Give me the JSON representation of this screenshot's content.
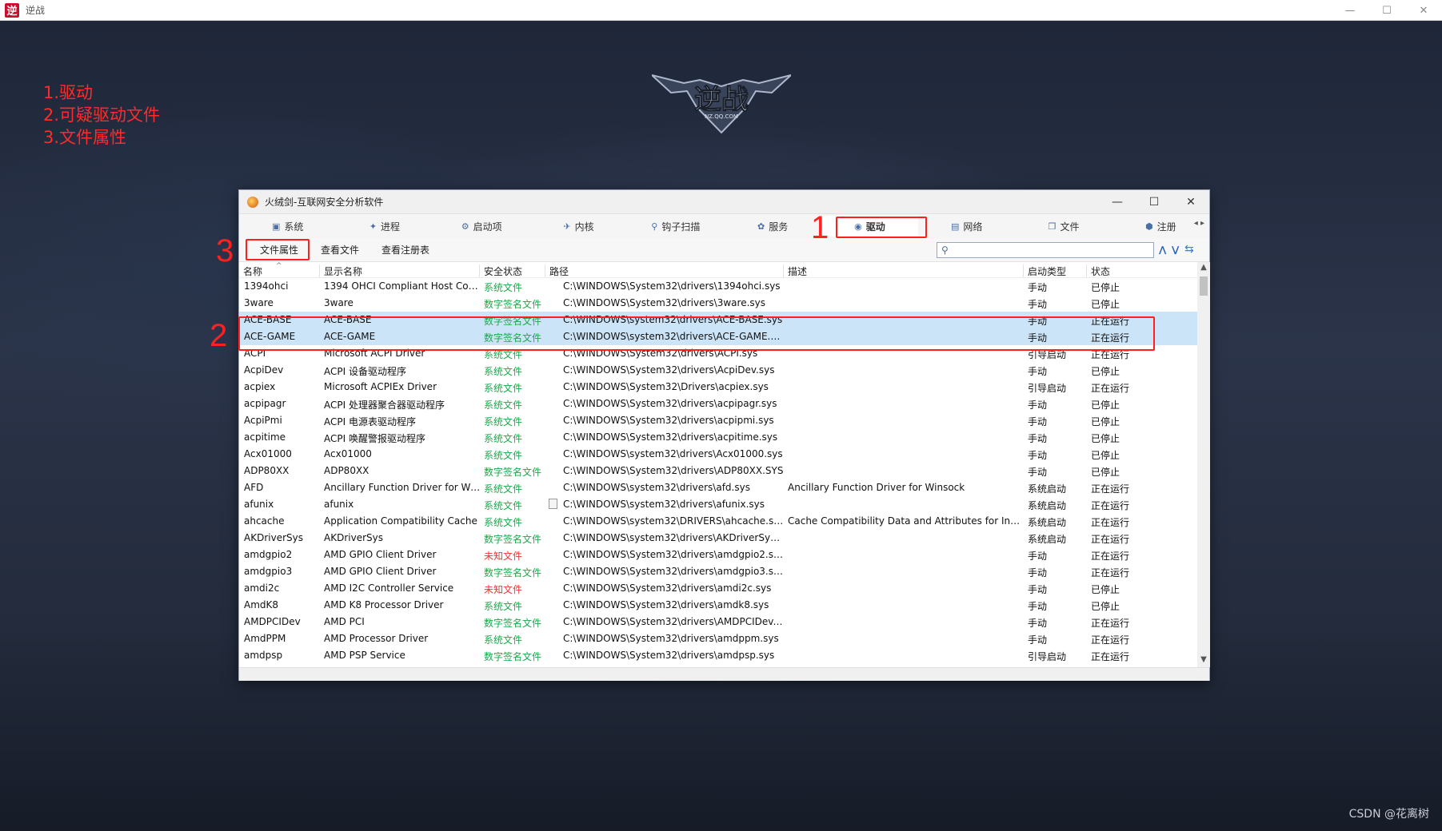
{
  "game_window": {
    "title": "逆战",
    "app_icon_glyph": "逆",
    "controls": {
      "minimize": "—",
      "maximize": "☐",
      "close": "✕"
    },
    "logo_text": "逆战",
    "logo_subtext": "NZ.QQ.COM"
  },
  "annotations": {
    "steps": [
      "1.驱动",
      "2.可疑驱动文件",
      "3.文件属性"
    ],
    "markers": [
      "1",
      "2",
      "3"
    ],
    "color": "#ff1f1f"
  },
  "watermark": "CSDN @花离树",
  "tool_window": {
    "title": "火绒剑-互联网安全分析软件",
    "controls": {
      "minimize": "—",
      "maximize": "☐",
      "close": "✕"
    },
    "tabs": [
      {
        "label": "系统",
        "icon": "computer-icon"
      },
      {
        "label": "进程",
        "icon": "process-icon"
      },
      {
        "label": "启动项",
        "icon": "startup-icon"
      },
      {
        "label": "内核",
        "icon": "kernel-icon"
      },
      {
        "label": "钩子扫描",
        "icon": "hook-scan-icon"
      },
      {
        "label": "服务",
        "icon": "service-icon"
      },
      {
        "label": "驱动",
        "icon": "driver-icon",
        "active": true
      },
      {
        "label": "网络",
        "icon": "network-icon"
      },
      {
        "label": "文件",
        "icon": "file-icon"
      },
      {
        "label": "注册",
        "icon": "registry-icon"
      }
    ],
    "tab_scroll": {
      "left": "◂",
      "right": "▸"
    },
    "toolbar": {
      "file_props": "文件属性",
      "view_file": "查看文件",
      "view_registry": "查看注册表"
    },
    "search": {
      "value": "",
      "placeholder": "",
      "prev": "⋀",
      "next": "⋁",
      "refresh": "⇆"
    },
    "columns": {
      "name": "名称",
      "display": "显示名称",
      "security": "安全状态",
      "path": "路径",
      "desc": "描述",
      "start": "启动类型",
      "status": "状态"
    },
    "rows": [
      {
        "name": "1394ohci",
        "display": "1394 OHCI Compliant Host Con...",
        "security": "系统文件",
        "sec_type": "system",
        "path": "C:\\WINDOWS\\System32\\drivers\\1394ohci.sys",
        "desc": "",
        "start": "手动",
        "status": "已停止"
      },
      {
        "name": "3ware",
        "display": "3ware",
        "security": "数字签名文件",
        "sec_type": "signed",
        "path": "C:\\WINDOWS\\System32\\drivers\\3ware.sys",
        "desc": "",
        "start": "手动",
        "status": "已停止"
      },
      {
        "name": "ACE-BASE",
        "display": "ACE-BASE",
        "security": "数字签名文件",
        "sec_type": "signed",
        "path": "C:\\WINDOWS\\system32\\drivers\\ACE-BASE.sys",
        "desc": "",
        "start": "手动",
        "status": "正在运行",
        "selected": true
      },
      {
        "name": "ACE-GAME",
        "display": "ACE-GAME",
        "security": "数字签名文件",
        "sec_type": "signed",
        "path": "C:\\WINDOWS\\system32\\drivers\\ACE-GAME.sys",
        "desc": "",
        "start": "手动",
        "status": "正在运行",
        "selected": true
      },
      {
        "name": "ACPI",
        "display": "Microsoft ACPI Driver",
        "security": "系统文件",
        "sec_type": "system",
        "path": "C:\\WINDOWS\\System32\\drivers\\ACPI.sys",
        "desc": "",
        "start": "引导启动",
        "status": "正在运行"
      },
      {
        "name": "AcpiDev",
        "display": "ACPI 设备驱动程序",
        "security": "系统文件",
        "sec_type": "system",
        "path": "C:\\WINDOWS\\System32\\drivers\\AcpiDev.sys",
        "desc": "",
        "start": "手动",
        "status": "已停止"
      },
      {
        "name": "acpiex",
        "display": "Microsoft ACPIEx Driver",
        "security": "系统文件",
        "sec_type": "system",
        "path": "C:\\WINDOWS\\System32\\Drivers\\acpiex.sys",
        "desc": "",
        "start": "引导启动",
        "status": "正在运行"
      },
      {
        "name": "acpipagr",
        "display": "ACPI 处理器聚合器驱动程序",
        "security": "系统文件",
        "sec_type": "system",
        "path": "C:\\WINDOWS\\System32\\drivers\\acpipagr.sys",
        "desc": "",
        "start": "手动",
        "status": "已停止"
      },
      {
        "name": "AcpiPmi",
        "display": "ACPI 电源表驱动程序",
        "security": "系统文件",
        "sec_type": "system",
        "path": "C:\\WINDOWS\\System32\\drivers\\acpipmi.sys",
        "desc": "",
        "start": "手动",
        "status": "已停止"
      },
      {
        "name": "acpitime",
        "display": "ACPI 唤醒警报驱动程序",
        "security": "系统文件",
        "sec_type": "system",
        "path": "C:\\WINDOWS\\System32\\drivers\\acpitime.sys",
        "desc": "",
        "start": "手动",
        "status": "已停止"
      },
      {
        "name": "Acx01000",
        "display": "Acx01000",
        "security": "系统文件",
        "sec_type": "system",
        "path": "C:\\WINDOWS\\system32\\drivers\\Acx01000.sys",
        "desc": "",
        "start": "手动",
        "status": "已停止"
      },
      {
        "name": "ADP80XX",
        "display": "ADP80XX",
        "security": "数字签名文件",
        "sec_type": "signed",
        "path": "C:\\WINDOWS\\System32\\drivers\\ADP80XX.SYS",
        "desc": "",
        "start": "手动",
        "status": "已停止"
      },
      {
        "name": "AFD",
        "display": "Ancillary Function Driver for Win...",
        "security": "系统文件",
        "sec_type": "system",
        "path": "C:\\WINDOWS\\system32\\drivers\\afd.sys",
        "desc": "Ancillary Function Driver for Winsock",
        "start": "系统启动",
        "status": "正在运行"
      },
      {
        "name": "afunix",
        "display": "afunix",
        "security": "系统文件",
        "sec_type": "system",
        "path": "C:\\WINDOWS\\system32\\drivers\\afunix.sys",
        "desc": "",
        "start": "系统启动",
        "status": "正在运行",
        "file_icon": true
      },
      {
        "name": "ahcache",
        "display": "Application Compatibility Cache",
        "security": "系统文件",
        "sec_type": "system",
        "path": "C:\\WINDOWS\\system32\\DRIVERS\\ahcache.sys",
        "desc": "Cache Compatibility Data and Attributes for Indiv...",
        "start": "系统启动",
        "status": "正在运行"
      },
      {
        "name": "AKDriverSys",
        "display": "AKDriverSys",
        "security": "数字签名文件",
        "sec_type": "signed",
        "path": "C:\\WINDOWS\\system32\\drivers\\AKDriverSys....",
        "desc": "",
        "start": "系统启动",
        "status": "正在运行"
      },
      {
        "name": "amdgpio2",
        "display": "AMD GPIO Client Driver",
        "security": "未知文件",
        "sec_type": "unknown",
        "path": "C:\\WINDOWS\\System32\\drivers\\amdgpio2.sys",
        "desc": "",
        "start": "手动",
        "status": "正在运行"
      },
      {
        "name": "amdgpio3",
        "display": "AMD GPIO Client Driver",
        "security": "数字签名文件",
        "sec_type": "signed",
        "path": "C:\\WINDOWS\\System32\\drivers\\amdgpio3.sys",
        "desc": "",
        "start": "手动",
        "status": "正在运行"
      },
      {
        "name": "amdi2c",
        "display": "AMD I2C Controller Service",
        "security": "未知文件",
        "sec_type": "unknown",
        "path": "C:\\WINDOWS\\System32\\drivers\\amdi2c.sys",
        "desc": "",
        "start": "手动",
        "status": "已停止"
      },
      {
        "name": "AmdK8",
        "display": "AMD K8 Processor Driver",
        "security": "系统文件",
        "sec_type": "system",
        "path": "C:\\WINDOWS\\System32\\drivers\\amdk8.sys",
        "desc": "",
        "start": "手动",
        "status": "已停止"
      },
      {
        "name": "AMDPCIDev",
        "display": "AMD PCI",
        "security": "数字签名文件",
        "sec_type": "signed",
        "path": "C:\\WINDOWS\\System32\\drivers\\AMDPCIDev....",
        "desc": "",
        "start": "手动",
        "status": "正在运行"
      },
      {
        "name": "AmdPPM",
        "display": "AMD Processor Driver",
        "security": "系统文件",
        "sec_type": "system",
        "path": "C:\\WINDOWS\\System32\\drivers\\amdppm.sys",
        "desc": "",
        "start": "手动",
        "status": "正在运行"
      },
      {
        "name": "amdpsp",
        "display": "AMD PSP Service",
        "security": "数字签名文件",
        "sec_type": "signed",
        "path": "C:\\WINDOWS\\System32\\drivers\\amdpsp.sys",
        "desc": "",
        "start": "引导启动",
        "status": "正在运行"
      }
    ]
  }
}
